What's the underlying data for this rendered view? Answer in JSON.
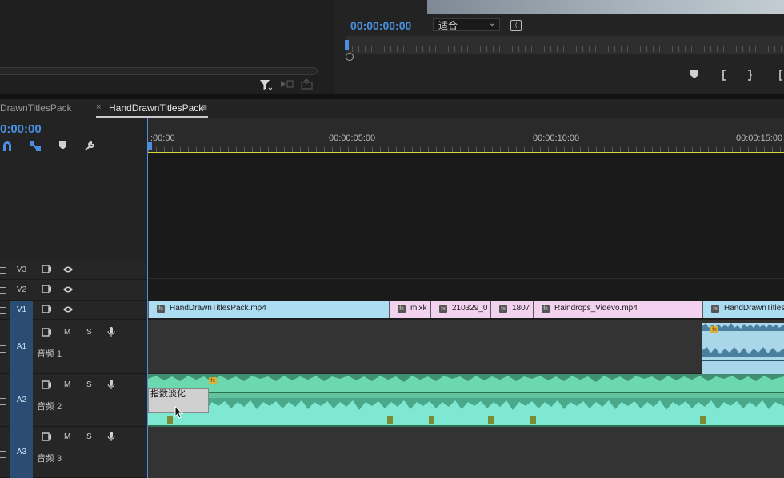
{
  "program": {
    "timecode": "00:00:00:00",
    "fit_label": "适合",
    "fit_arrow": "⌄",
    "settings_icon": "settings-icon",
    "transport_icons": [
      "marker-icon",
      "mark-in-icon",
      "mark-out-icon",
      "go-to-in-icon"
    ]
  },
  "source": {
    "toolbar_icons": [
      "filter-icon",
      "insert-icon",
      "export-icon"
    ]
  },
  "timeline": {
    "tabs": [
      {
        "label": "DrawnTitlesPack",
        "active": false
      },
      {
        "label": "HandDrawnTitlesPack",
        "active": true
      }
    ],
    "close_glyph": "×",
    "menu_glyph": "≡",
    "timecode": "0:00:00",
    "ruler_labels": [
      ":00:00",
      "00:00:05:00",
      "00:00:10:00",
      "00:00:15:00"
    ],
    "tracks": {
      "video": [
        {
          "id": "V3"
        },
        {
          "id": "V2"
        },
        {
          "id": "V1",
          "targeted": true
        }
      ],
      "audio": [
        {
          "id": "A1",
          "name": "音频 1",
          "m": "M",
          "s": "S"
        },
        {
          "id": "A2",
          "name": "音频 2",
          "m": "M",
          "s": "S"
        },
        {
          "id": "A3",
          "name": "音频 3",
          "m": "M",
          "s": "S"
        }
      ]
    },
    "video_clips": [
      {
        "label": "HandDrawnTitlesPack.mp4",
        "color": "#acdcf2"
      },
      {
        "label": "mixk",
        "color": "#f3d2ef"
      },
      {
        "label": "210329_0",
        "color": "#f3d2ef"
      },
      {
        "label": "1807",
        "color": "#f3d2ef"
      },
      {
        "label": "Raindrops_Videvo.mp4",
        "color": "#f3d2ef"
      },
      {
        "label": "HandDrawnTitlesP",
        "color": "#acdcf2"
      }
    ],
    "fx_badge": "fx",
    "tooltip": "指数淡化",
    "colors": {
      "accent": "#4a8fe0",
      "audio_clip": "#62c49d",
      "work_area": "#d8d840"
    }
  }
}
